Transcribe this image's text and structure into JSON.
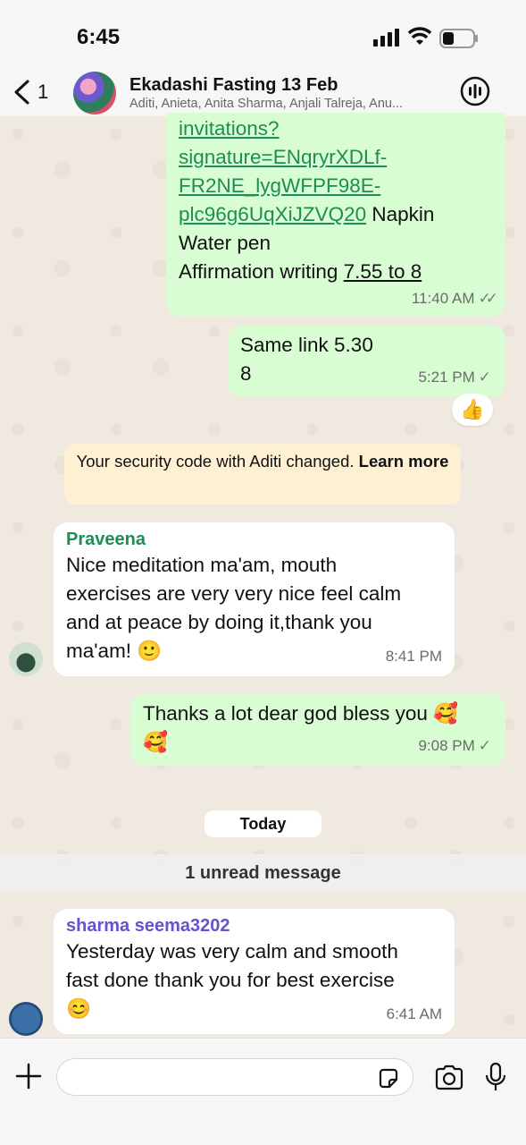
{
  "status_bar": {
    "time": "6:45"
  },
  "header": {
    "back_count": "1",
    "title": "Ekadashi Fasting 13 Feb",
    "members": "Aditi, Anieta, Anita Sharma, Anjali Talreja, Anu..."
  },
  "messages": {
    "m1": {
      "link_lines": [
        "invitations?",
        "signature=ENqryrXDLf-",
        "FR2NE_lygWFPF98E-",
        "plc96g6UqXiJZVQ20"
      ],
      "after_link": " Napkin",
      "line_water": "Water pen",
      "line_affirm": "Affirmation writing ",
      "affirm_time": "7.55 to 8",
      "time": "11:40 AM",
      "status": "✓✓"
    },
    "m2": {
      "line1": "Same link 5.30",
      "line2": "8",
      "time": "5:21 PM",
      "status": "✓",
      "reaction": "👍"
    },
    "system_notice": {
      "text": "Your security code with Aditi changed. ",
      "action": "Learn more"
    },
    "m3": {
      "sender": "Praveena",
      "lines": [
        "Nice meditation ma'am,  mouth",
        "exercises are very very nice feel calm",
        "and at peace by doing it,thank you",
        "ma'am! 🙂"
      ],
      "time": "8:41 PM"
    },
    "m4": {
      "line1": "Thanks a lot dear god bless you 🥰",
      "line2": "🥰",
      "time": "9:08 PM",
      "status": "✓"
    },
    "date_divider": "Today",
    "unread_banner": "1 unread message",
    "m5": {
      "sender": "sharma seema3202",
      "lines": [
        "Yesterday was very calm and smooth",
        "fast done thank you for best exercise",
        "😊"
      ],
      "time": "6:41 AM"
    }
  },
  "composer": {
    "value": "",
    "placeholder": ""
  },
  "colors": {
    "outgoing_bubble": "#d9fdd3",
    "incoming_bubble": "#ffffff",
    "link": "#1e8d55",
    "sender_praveena": "#1e8d55",
    "sender_sharma": "#6a4fd0",
    "notice_bg": "#fdf0d3"
  },
  "icons": [
    "back-chevron-icon",
    "group-call-icon",
    "plus-icon",
    "sticker-icon",
    "camera-icon",
    "mic-icon",
    "signal-icon",
    "wifi-icon",
    "battery-icon"
  ]
}
